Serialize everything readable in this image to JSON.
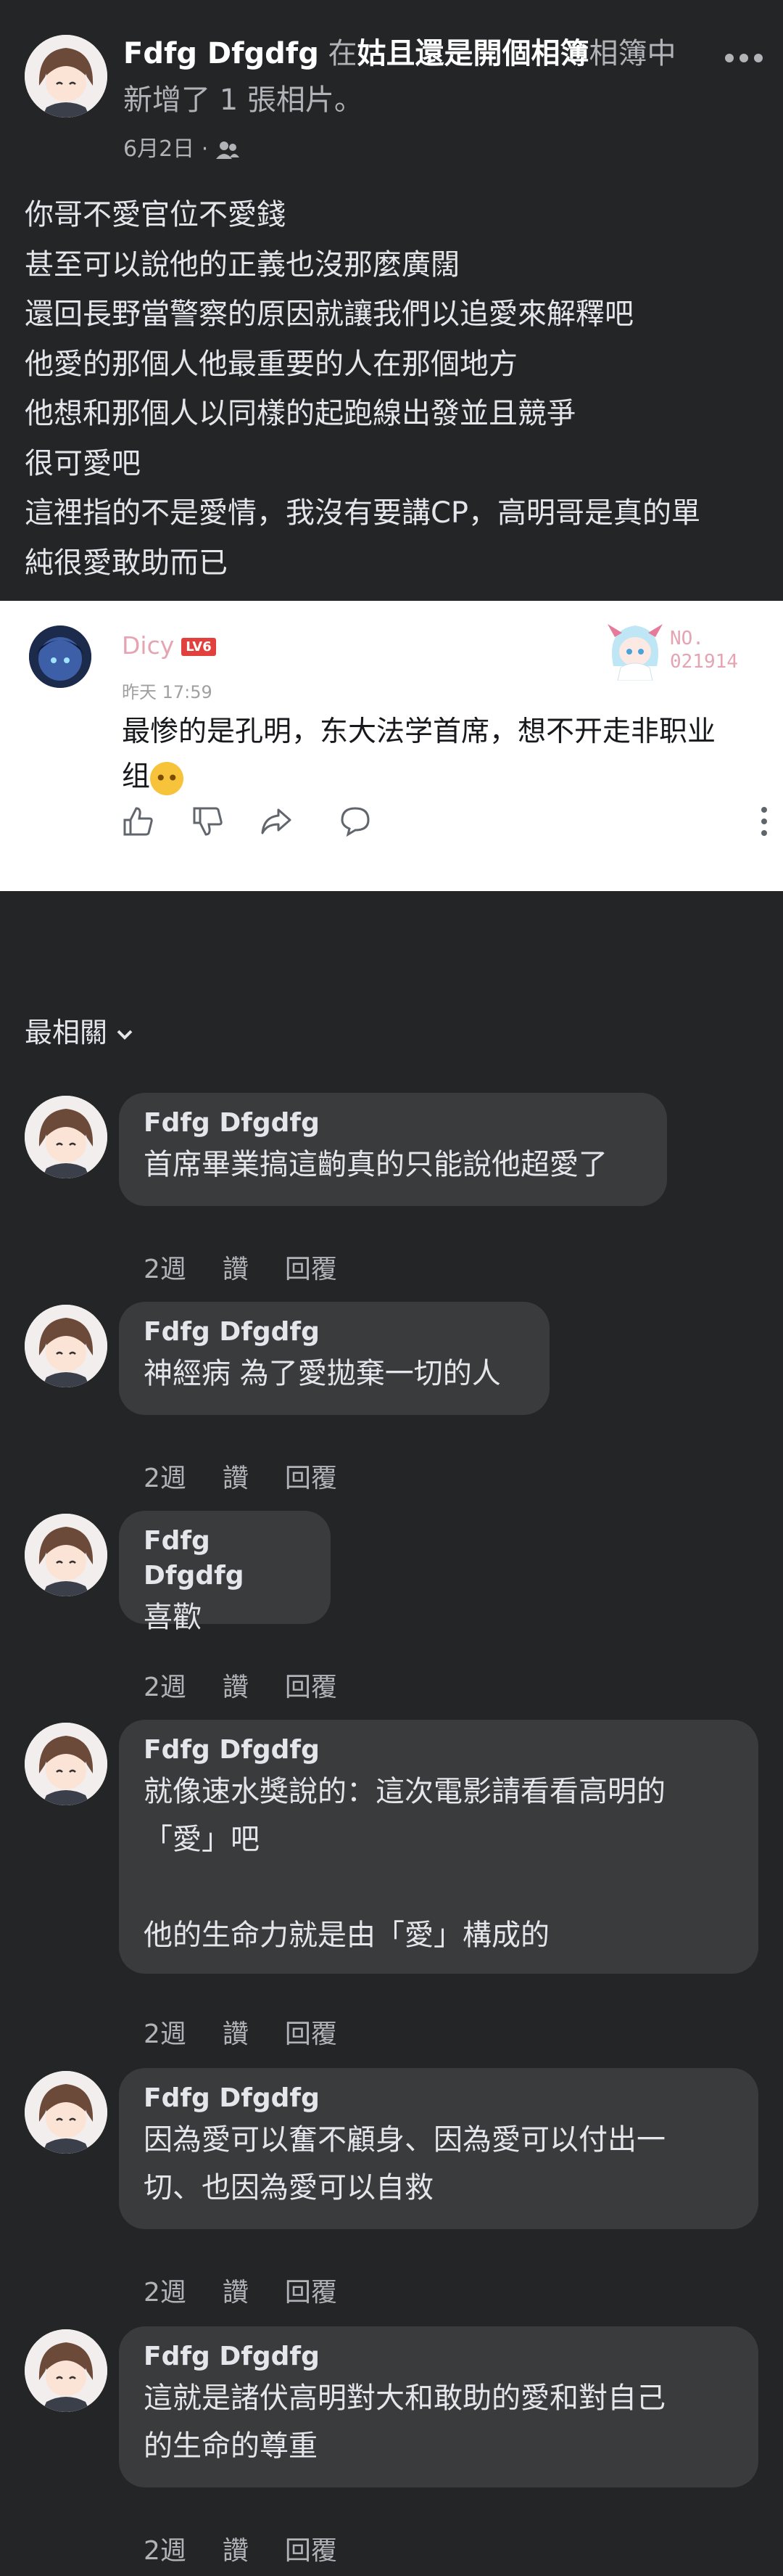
{
  "post": {
    "author": "Fdfg Dfgdfg",
    "in_word": "在",
    "album": "姑且還是開個相簿",
    "album_suffix": "相簿中",
    "line2": "新增了 1 張相片。",
    "date": "6月2日",
    "dot": "·",
    "privacy_icon": "friends-icon",
    "more_icon": "more-horizontal-icon",
    "body_lines": [
      "你哥不愛官位不愛錢",
      "甚至可以說他的正義也沒那麼廣闊",
      "還回長野當警察的原因就讓我們以追愛來解釋吧",
      "他愛的那個人他最重要的人在那個地方",
      "他想和那個人以同樣的起跑線出發並且競爭",
      "很可愛吧",
      "這裡指的不是愛情，我沒有要講CP，高明哥是真的單",
      "純很愛敢助而已"
    ]
  },
  "embed": {
    "username": "Dicy",
    "level": "LV6",
    "time": "昨天 17:59",
    "badge_no": "NO.",
    "badge_num": "021914",
    "content_line1": "最惨的是孔明，东大法学首席，想不开走非职业",
    "content_line2": "组",
    "actions": [
      "thumb-up-icon",
      "thumb-down-icon",
      "share-icon",
      "comment-icon"
    ],
    "more_icon": "more-vertical-icon"
  },
  "sort": {
    "label": "最相關"
  },
  "comments": [
    {
      "name": "Fdfg Dfgdfg",
      "text": "首席畢業搞這齣真的只能說他超愛了",
      "time": "2週",
      "like": "讚",
      "reply": "回覆"
    },
    {
      "name": "Fdfg Dfgdfg",
      "text": "神經病 為了愛拋棄一切的人",
      "time": "2週",
      "like": "讚",
      "reply": "回覆"
    },
    {
      "name": "Fdfg Dfgdfg",
      "text": "喜歡",
      "time": "2週",
      "like": "讚",
      "reply": "回覆"
    },
    {
      "name": "Fdfg Dfgdfg",
      "text": "就像速水獎說的：這次電影請看看高明的\n「愛」吧\n\n他的生命力就是由「愛」構成的",
      "time": "2週",
      "like": "讚",
      "reply": "回覆"
    },
    {
      "name": "Fdfg Dfgdfg",
      "text": "因為愛可以奮不顧身、因為愛可以付出一\n切、也因為愛可以自救",
      "time": "2週",
      "like": "讚",
      "reply": "回覆"
    },
    {
      "name": "Fdfg Dfgdfg",
      "text": "這就是諸伏高明對大和敢助的愛和對自己\n的生命的尊重",
      "time": "2週",
      "like": "讚",
      "reply": "回覆"
    }
  ]
}
